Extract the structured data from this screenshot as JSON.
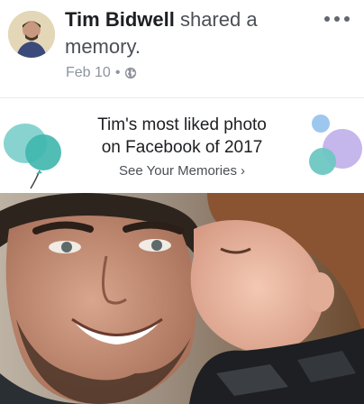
{
  "post": {
    "author": "Tim Bidwell",
    "action_line1": " shared a",
    "action_line2": "memory.",
    "date": "Feb 10",
    "separator": "•",
    "privacy_icon": "globe-icon",
    "more_icon": "more-options-icon"
  },
  "memory": {
    "name": "Tim",
    "title_rest": "'s most liked photo",
    "title_line2": "on Facebook of 2017",
    "link_label": "See Your Memories",
    "link_icon": "chevron-right-icon"
  },
  "colors": {
    "name": "#1c1e21",
    "body_text": "#4b4f56",
    "meta": "#8d949e",
    "balloon_teal": "#5cc8c8",
    "bubble_purple": "#b9a7e6",
    "bubble_blue": "#8cbff0"
  }
}
